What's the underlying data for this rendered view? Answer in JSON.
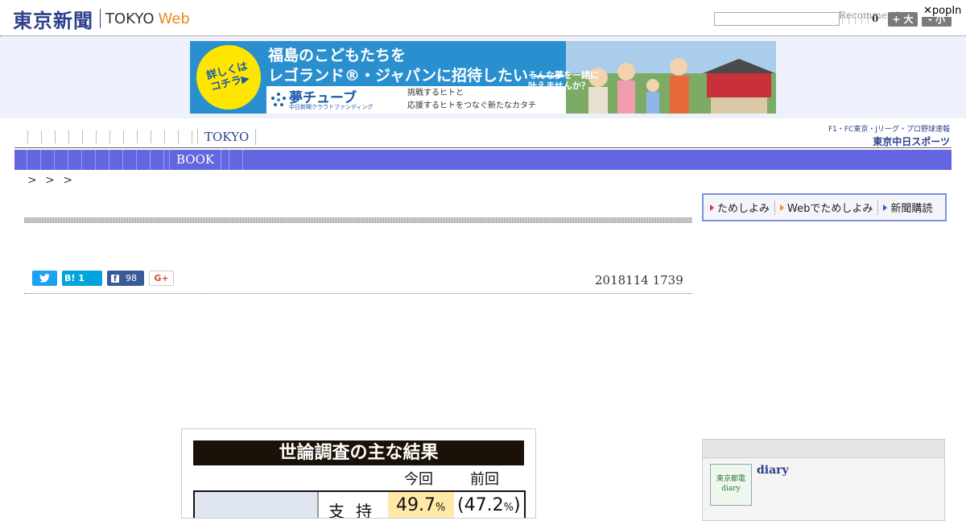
{
  "header": {
    "logo_ja": "東京新聞",
    "logo_en": "TOKYO",
    "logo_web": "Web",
    "search_value": "",
    "recommend_label": "Recommend",
    "counter_value": "0",
    "font_large_label": "+ 大",
    "font_small_label": "- 小",
    "popin_label": "✕popIn"
  },
  "ad": {
    "badge": "詳しくは\nコチラ▶",
    "headline_1": "福島のこどもたちを",
    "headline_2": "レゴランド®・ジャパンに招待したい ――",
    "dream": "そんな夢を一緒に\n叶えませんか？",
    "brand": "夢チューブ",
    "brand_sub": "中日新聞クラウドファンディング",
    "tagline_1": "挑戦するヒトと",
    "tagline_2": "応援するヒトをつなぐ新たなカタチ"
  },
  "nav": {
    "tokyo_label": "TOKYO",
    "sports_line1": "F1・FC東京・Jリーグ・プロ野球速報",
    "sports_line2": "東京中日スポーツ"
  },
  "category_bar": {
    "book_label": "BOOK"
  },
  "breadcrumb": "> > >",
  "promo": {
    "items": [
      "ためしよみ",
      "Webでためしよみ",
      "新聞購読"
    ]
  },
  "share": {
    "hatena_label": "B! 1",
    "facebook_count": "98",
    "gplus_label": "G+"
  },
  "article": {
    "date": "2018114 1739"
  },
  "figure": {
    "title": "世論調査の主な結果",
    "col_now": "今回",
    "col_prev": "前回",
    "row_label": "支持",
    "now_value": "49.7",
    "prev_value": "(47.2",
    "unit": "%",
    "prev_close": ")"
  },
  "sidebar": {
    "diary_thumb": "東京都電\ndiary",
    "diary_label": "diary"
  },
  "colors": {
    "brand_navy": "#2b3f8c",
    "category_bar": "#6366e0",
    "ad_blue": "#2a8fcf",
    "web_orange": "#e88a1a"
  }
}
